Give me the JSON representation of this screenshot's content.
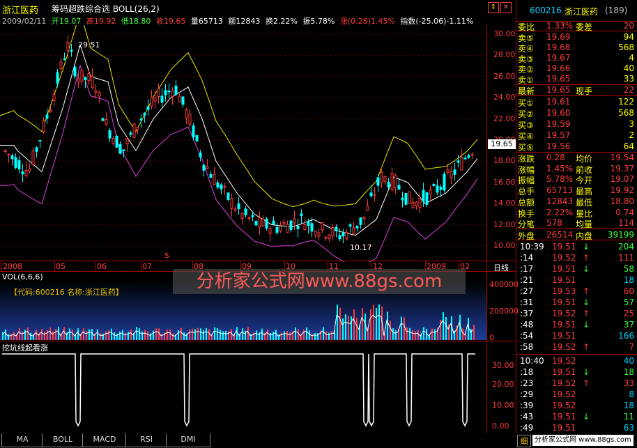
{
  "header": {
    "stock_name": "浙江医药",
    "indicator_title": "筹码超跌综合选 BOLL(26,2)",
    "icons": [
      "up-down-arrow-icon",
      "close-x-icon"
    ]
  },
  "quote_line": {
    "date": "2009/02/11",
    "open": "开19.07",
    "high": "高19.92",
    "low": "低18.80",
    "close": "收19.65",
    "volume": "量65713",
    "amount": "额12843",
    "turnover": "换2.22%",
    "amplitude": "振5.78%",
    "change": "涨(0.28)1.45%",
    "index": "指数(-25.06)-1.11%"
  },
  "price_axis": [
    "30.00",
    "28.00",
    "26.00",
    "24.00",
    "22.00",
    "20.00",
    "18.00",
    "16.00",
    "14.00",
    "12.00",
    "10.00"
  ],
  "current_price_tag": "19.65",
  "annotations": {
    "peak": "29.51",
    "trough": "10.17",
    "marker": "$"
  },
  "time_axis": [
    "2008",
    "05",
    "06",
    "07",
    "08",
    "09",
    "10",
    "11",
    "12",
    "2009",
    "02"
  ],
  "period_label": "日线",
  "volume_pane": {
    "title": "VOL(6,6,6)",
    "code_label": "【代码:600216 名称:浙江医药】",
    "axis": [
      "400000",
      "200000",
      "0"
    ]
  },
  "signal_pane": {
    "title": "挖坑线起看涨",
    "axis": [
      "30.00",
      "20.00",
      "10.00",
      "0.00"
    ]
  },
  "watermark": "分析家公式网www.88gs.com",
  "tabs": [
    "MA",
    "BOLL",
    "MACD",
    "RSI",
    "DMI"
  ],
  "right_panel": {
    "code": "600216",
    "name": "浙江医药",
    "count": "(189)",
    "weibi": {
      "label": "委比",
      "value": "1.33%"
    },
    "weicha": {
      "label": "委差",
      "value": "20"
    },
    "asks": [
      {
        "label": "卖⑤",
        "price": "19.69",
        "vol": "94"
      },
      {
        "label": "卖④",
        "price": "19.68",
        "vol": "568"
      },
      {
        "label": "卖③",
        "price": "19.67",
        "vol": "4"
      },
      {
        "label": "卖②",
        "price": "19.66",
        "vol": "40"
      },
      {
        "label": "卖①",
        "price": "19.65",
        "vol": "33"
      }
    ],
    "latest": {
      "label": "最新",
      "value": "19.65"
    },
    "xianshou": {
      "label": "现手",
      "value": "22"
    },
    "bids": [
      {
        "label": "买①",
        "price": "19.61",
        "vol": "122"
      },
      {
        "label": "买②",
        "price": "19.60",
        "vol": "568"
      },
      {
        "label": "买③",
        "price": "19.59",
        "vol": "3"
      },
      {
        "label": "买④",
        "price": "19.57",
        "vol": "2"
      },
      {
        "label": "买⑤",
        "price": "19.56",
        "vol": "64"
      }
    ],
    "stats": [
      {
        "l1": "涨跌",
        "v1": "0.28",
        "l2": "均价",
        "v2": "19.54"
      },
      {
        "l1": "涨幅",
        "v1": "1.45%",
        "l2": "前收",
        "v2": "19.37"
      },
      {
        "l1": "振幅",
        "v1": "5.78%",
        "l2": "今开",
        "v2": "19.07"
      },
      {
        "l1": "总手",
        "v1": "65713",
        "l2": "最高",
        "v2": "19.92"
      },
      {
        "l1": "总额",
        "v1": "12843",
        "l2": "最低",
        "v2": "18.80"
      },
      {
        "l1": "换手",
        "v1": "2.22%",
        "l2": "量比",
        "v2": "0.74"
      },
      {
        "l1": "分笔",
        "v1": "578",
        "l2": "均量",
        "v2": "114"
      }
    ],
    "waipan": {
      "label": "外盘",
      "value": "26514"
    },
    "neipan": {
      "label": "内盘",
      "value": "39199"
    },
    "ticks": [
      {
        "t": "10:39",
        "p": "19.51",
        "d": "↓",
        "v": "204"
      },
      {
        "t": ":14",
        "p": "19.52",
        "d": "↑",
        "v": "111"
      },
      {
        "t": ":17",
        "p": "19.51",
        "d": "↓",
        "v": "58"
      },
      {
        "t": ":21",
        "p": "19.51",
        "d": "",
        "v": "18"
      },
      {
        "t": ":27",
        "p": "19.53",
        "d": "↑",
        "v": "60"
      },
      {
        "t": ":31",
        "p": "19.51",
        "d": "↓",
        "v": "57"
      },
      {
        "t": ":37",
        "p": "19.52",
        "d": "↑",
        "v": "25"
      },
      {
        "t": ":48",
        "p": "19.51",
        "d": "↓",
        "v": "37"
      },
      {
        "t": ":54",
        "p": "19.51",
        "d": "",
        "v": "166"
      },
      {
        "t": ":58",
        "p": "19.52",
        "d": "↑",
        "v": "7"
      },
      {
        "t": "10:40",
        "p": "19.52",
        "d": "",
        "v": "40"
      },
      {
        "t": ":18",
        "p": "19.51",
        "d": "↓",
        "v": "18"
      },
      {
        "t": ":23",
        "p": "19.52",
        "d": "↑",
        "v": "33"
      },
      {
        "t": ":29",
        "p": "19.52",
        "d": "",
        "v": "8"
      },
      {
        "t": ":39",
        "p": "19.52",
        "d": "",
        "v": "18"
      },
      {
        "t": ":43",
        "p": "19.51",
        "d": "↓",
        "v": "11"
      },
      {
        "t": ":49",
        "p": "19.51",
        "d": "",
        "v": "63"
      }
    ],
    "footer": {
      "tab": "细",
      "site": "分析家公式网 www.88gs.com"
    }
  },
  "colors": {
    "up": "#ff3b3b",
    "down": "#00ffff",
    "bg": "#000000",
    "grid": "#b00000"
  }
}
